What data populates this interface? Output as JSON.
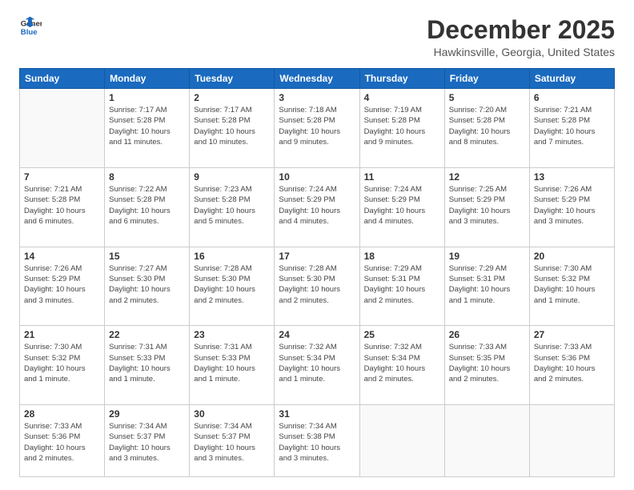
{
  "header": {
    "logo_general": "General",
    "logo_blue": "Blue",
    "month": "December 2025",
    "location": "Hawkinsville, Georgia, United States"
  },
  "days_of_week": [
    "Sunday",
    "Monday",
    "Tuesday",
    "Wednesday",
    "Thursday",
    "Friday",
    "Saturday"
  ],
  "weeks": [
    [
      {
        "day": "",
        "info": ""
      },
      {
        "day": "1",
        "info": "Sunrise: 7:17 AM\nSunset: 5:28 PM\nDaylight: 10 hours\nand 11 minutes."
      },
      {
        "day": "2",
        "info": "Sunrise: 7:17 AM\nSunset: 5:28 PM\nDaylight: 10 hours\nand 10 minutes."
      },
      {
        "day": "3",
        "info": "Sunrise: 7:18 AM\nSunset: 5:28 PM\nDaylight: 10 hours\nand 9 minutes."
      },
      {
        "day": "4",
        "info": "Sunrise: 7:19 AM\nSunset: 5:28 PM\nDaylight: 10 hours\nand 9 minutes."
      },
      {
        "day": "5",
        "info": "Sunrise: 7:20 AM\nSunset: 5:28 PM\nDaylight: 10 hours\nand 8 minutes."
      },
      {
        "day": "6",
        "info": "Sunrise: 7:21 AM\nSunset: 5:28 PM\nDaylight: 10 hours\nand 7 minutes."
      }
    ],
    [
      {
        "day": "7",
        "info": "Sunrise: 7:21 AM\nSunset: 5:28 PM\nDaylight: 10 hours\nand 6 minutes."
      },
      {
        "day": "8",
        "info": "Sunrise: 7:22 AM\nSunset: 5:28 PM\nDaylight: 10 hours\nand 6 minutes."
      },
      {
        "day": "9",
        "info": "Sunrise: 7:23 AM\nSunset: 5:28 PM\nDaylight: 10 hours\nand 5 minutes."
      },
      {
        "day": "10",
        "info": "Sunrise: 7:24 AM\nSunset: 5:29 PM\nDaylight: 10 hours\nand 4 minutes."
      },
      {
        "day": "11",
        "info": "Sunrise: 7:24 AM\nSunset: 5:29 PM\nDaylight: 10 hours\nand 4 minutes."
      },
      {
        "day": "12",
        "info": "Sunrise: 7:25 AM\nSunset: 5:29 PM\nDaylight: 10 hours\nand 3 minutes."
      },
      {
        "day": "13",
        "info": "Sunrise: 7:26 AM\nSunset: 5:29 PM\nDaylight: 10 hours\nand 3 minutes."
      }
    ],
    [
      {
        "day": "14",
        "info": "Sunrise: 7:26 AM\nSunset: 5:29 PM\nDaylight: 10 hours\nand 3 minutes."
      },
      {
        "day": "15",
        "info": "Sunrise: 7:27 AM\nSunset: 5:30 PM\nDaylight: 10 hours\nand 2 minutes."
      },
      {
        "day": "16",
        "info": "Sunrise: 7:28 AM\nSunset: 5:30 PM\nDaylight: 10 hours\nand 2 minutes."
      },
      {
        "day": "17",
        "info": "Sunrise: 7:28 AM\nSunset: 5:30 PM\nDaylight: 10 hours\nand 2 minutes."
      },
      {
        "day": "18",
        "info": "Sunrise: 7:29 AM\nSunset: 5:31 PM\nDaylight: 10 hours\nand 2 minutes."
      },
      {
        "day": "19",
        "info": "Sunrise: 7:29 AM\nSunset: 5:31 PM\nDaylight: 10 hours\nand 1 minute."
      },
      {
        "day": "20",
        "info": "Sunrise: 7:30 AM\nSunset: 5:32 PM\nDaylight: 10 hours\nand 1 minute."
      }
    ],
    [
      {
        "day": "21",
        "info": "Sunrise: 7:30 AM\nSunset: 5:32 PM\nDaylight: 10 hours\nand 1 minute."
      },
      {
        "day": "22",
        "info": "Sunrise: 7:31 AM\nSunset: 5:33 PM\nDaylight: 10 hours\nand 1 minute."
      },
      {
        "day": "23",
        "info": "Sunrise: 7:31 AM\nSunset: 5:33 PM\nDaylight: 10 hours\nand 1 minute."
      },
      {
        "day": "24",
        "info": "Sunrise: 7:32 AM\nSunset: 5:34 PM\nDaylight: 10 hours\nand 1 minute."
      },
      {
        "day": "25",
        "info": "Sunrise: 7:32 AM\nSunset: 5:34 PM\nDaylight: 10 hours\nand 2 minutes."
      },
      {
        "day": "26",
        "info": "Sunrise: 7:33 AM\nSunset: 5:35 PM\nDaylight: 10 hours\nand 2 minutes."
      },
      {
        "day": "27",
        "info": "Sunrise: 7:33 AM\nSunset: 5:36 PM\nDaylight: 10 hours\nand 2 minutes."
      }
    ],
    [
      {
        "day": "28",
        "info": "Sunrise: 7:33 AM\nSunset: 5:36 PM\nDaylight: 10 hours\nand 2 minutes."
      },
      {
        "day": "29",
        "info": "Sunrise: 7:34 AM\nSunset: 5:37 PM\nDaylight: 10 hours\nand 3 minutes."
      },
      {
        "day": "30",
        "info": "Sunrise: 7:34 AM\nSunset: 5:37 PM\nDaylight: 10 hours\nand 3 minutes."
      },
      {
        "day": "31",
        "info": "Sunrise: 7:34 AM\nSunset: 5:38 PM\nDaylight: 10 hours\nand 3 minutes."
      },
      {
        "day": "",
        "info": ""
      },
      {
        "day": "",
        "info": ""
      },
      {
        "day": "",
        "info": ""
      }
    ]
  ]
}
